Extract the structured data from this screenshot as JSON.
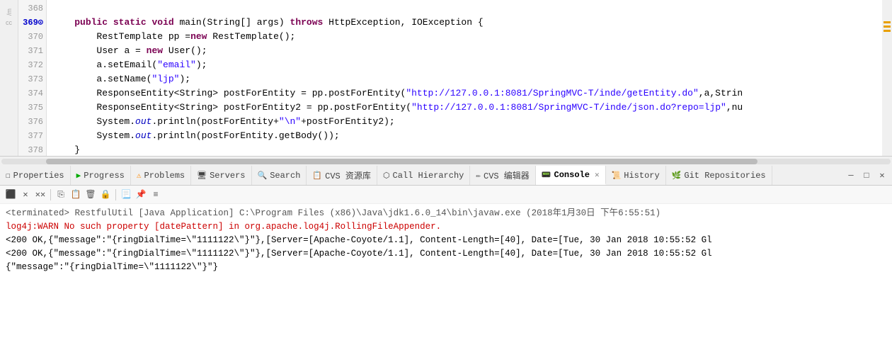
{
  "editor": {
    "lines": [
      {
        "num": "368",
        "code": "",
        "type": "normal",
        "indent": ""
      },
      {
        "num": "369",
        "code": "    public static void main(String[] args) throws HttpException, IOException {",
        "type": "normal",
        "breakpoint": true
      },
      {
        "num": "370",
        "code": "        RestTemplate pp =new RestTemplate();",
        "type": "normal"
      },
      {
        "num": "371",
        "code": "        User a = new User();",
        "type": "normal"
      },
      {
        "num": "372",
        "code": "        a.setEmail(\"email\");",
        "type": "normal"
      },
      {
        "num": "373",
        "code": "        a.setName(\"ljp\");",
        "type": "normal"
      },
      {
        "num": "374",
        "code": "        ResponseEntity<String> postForEntity = pp.postForEntity(\"http://127.0.0.1:8081/SpringMVC-T/inde/getEntity.do\",a,Strin",
        "type": "normal"
      },
      {
        "num": "375",
        "code": "        ResponseEntity<String> postForEntity2 = pp.postForEntity(\"http://127.0.0.1:8081/SpringMVC-T/inde/json.do?repo=ljp\",nu",
        "type": "normal"
      },
      {
        "num": "376",
        "code": "        System.out.println(postForEntity+\"\\n\"+postForEntity2);",
        "type": "normal"
      },
      {
        "num": "377",
        "code": "        System.out.println(postForEntity.getBody());",
        "type": "normal"
      },
      {
        "num": "378",
        "code": "    }",
        "type": "normal"
      }
    ]
  },
  "tabs": [
    {
      "id": "properties",
      "label": "Properties",
      "icon": "☐",
      "active": false
    },
    {
      "id": "progress",
      "label": "Progress",
      "icon": "▶",
      "active": false
    },
    {
      "id": "problems",
      "label": "Problems",
      "icon": "⚠",
      "active": false
    },
    {
      "id": "servers",
      "label": "Servers",
      "icon": "🖥",
      "active": false
    },
    {
      "id": "search",
      "label": "Search",
      "icon": "🔍",
      "active": false
    },
    {
      "id": "cvs-resources",
      "label": "CVS 资源库",
      "icon": "📋",
      "active": false
    },
    {
      "id": "call-hierarchy",
      "label": "Call Hierarchy",
      "icon": "⬡",
      "active": false
    },
    {
      "id": "cvs-editor",
      "label": "CVS 编辑器",
      "icon": "✏",
      "active": false
    },
    {
      "id": "console",
      "label": "Console",
      "icon": "📟",
      "active": true
    },
    {
      "id": "history",
      "label": "History",
      "icon": "📜",
      "active": false
    },
    {
      "id": "git-repositories",
      "label": "Git Repositories",
      "icon": "🌿",
      "active": false
    }
  ],
  "console": {
    "terminated_line": "<terminated> RestfulUtil [Java Application] C:\\Program Files (x86)\\Java\\jdk1.6.0_14\\bin\\javaw.exe (2018年1月30日 下午6:55:51)",
    "warn_line": "log4j:WARN No such property [datePattern] in org.apache.log4j.RollingFileAppender.",
    "response_line1": "<200 OK,{\"message\":\"{ringDialTime=\\\"1111122\\\"}\"},[Server=[Apache-Coyote/1.1], Content-Length=[40], Date=[Tue, 30 Jan 2018 10:55:52 Gl",
    "response_line2": "<200 OK,{\"message\":\"{ringDialTime=\\\"1111122\\\"}\"},[Server=[Apache-Coyote/1.1], Content-Length=[40], Date=[Tue, 30 Jan 2018 10:55:52 Gl",
    "json_line": "{\"message\":\"{ringDialTime=\\\"1111122\\\"}\"}"
  }
}
